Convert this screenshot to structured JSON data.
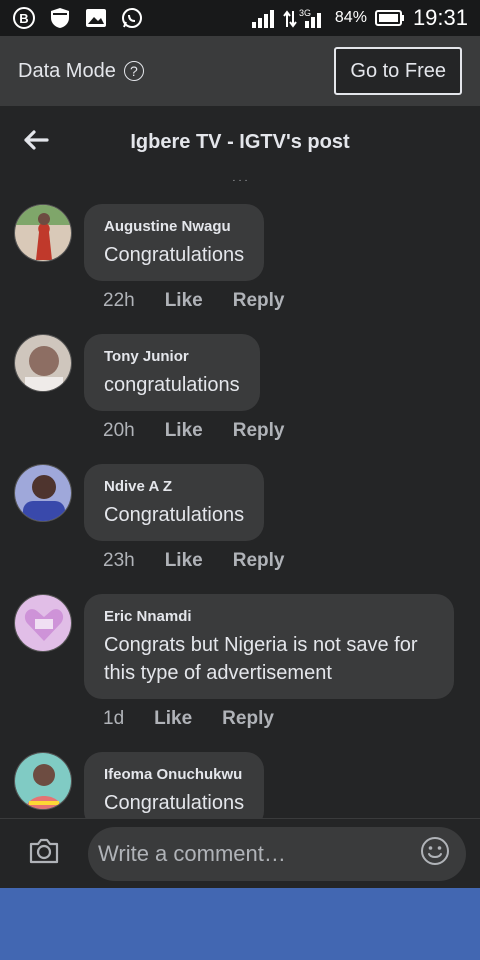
{
  "status_bar": {
    "icons": [
      "b-circle-icon",
      "shield-icon",
      "image-icon",
      "whatsapp-icon",
      "signal-icon",
      "network-3g-icon"
    ],
    "network_type": "3G",
    "battery": "84%",
    "time": "19:31"
  },
  "data_mode": {
    "label": "Data Mode",
    "help_icon": "?",
    "go_free_label": "Go to Free"
  },
  "header": {
    "back_icon": "arrow-left-icon",
    "title": "Igbere TV - IGTV's post"
  },
  "comments": [
    {
      "author": "Augustine Nwagu",
      "text": "Congratulations",
      "time": "22h",
      "like": "Like",
      "reply": "Reply",
      "avatar_color": "#c0392b"
    },
    {
      "author": "Tony Junior",
      "text": "congratulations",
      "time": "20h",
      "like": "Like",
      "reply": "Reply",
      "avatar_color": "#8d6e63"
    },
    {
      "author": "Ndive A Z",
      "text": "Congratulations",
      "time": "23h",
      "like": "Like",
      "reply": "Reply",
      "avatar_color": "#5c6bc0"
    },
    {
      "author": "Eric Nnamdi",
      "text_line1": "Congrats but Nigeria is not save for",
      "text_line2": "this type of advertisement",
      "time": "1d",
      "like": "Like",
      "reply": "Reply",
      "avatar_color": "#ce93d8"
    },
    {
      "author": "Ifeoma Onuchukwu",
      "text": "Congratulations",
      "avatar_color": "#e57373"
    }
  ],
  "composer": {
    "camera_icon": "camera-icon",
    "placeholder": "Write a comment…",
    "emoji_icon": "smiley-icon"
  },
  "colors": {
    "background": "#242526",
    "bubble": "#3a3b3c",
    "nav_bar": "#4267b2"
  }
}
